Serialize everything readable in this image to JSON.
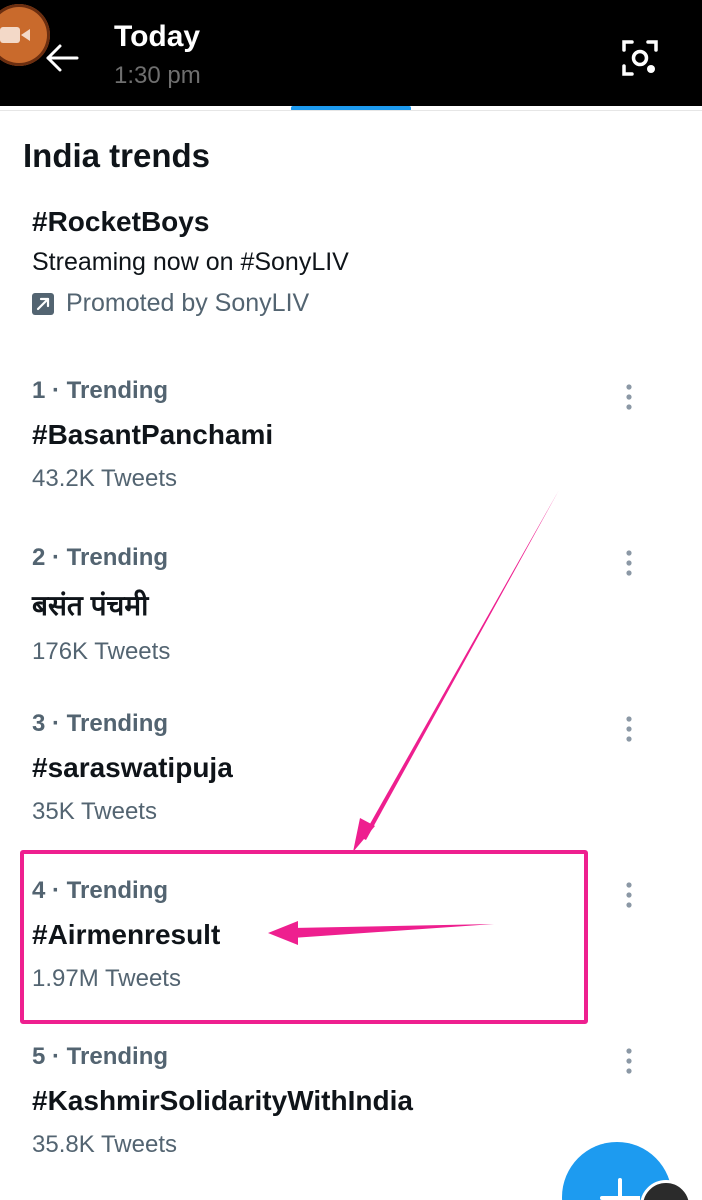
{
  "header": {
    "title": "Today",
    "time": "1:30 pm"
  },
  "section": {
    "title": "India trends"
  },
  "promoted": {
    "hashtag": "#RocketBoys",
    "subtitle": "Streaming now on #SonyLIV",
    "promoted_by": "Promoted by SonyLIV"
  },
  "trends": [
    {
      "meta": "1 · Trending",
      "name": "#BasantPanchami",
      "count": "43.2K Tweets"
    },
    {
      "meta": "2 · Trending",
      "name": "बसंत पंचमी",
      "count": "176K Tweets"
    },
    {
      "meta": "3 · Trending",
      "name": "#saraswatipuja",
      "count": "35K Tweets"
    },
    {
      "meta": "4 · Trending",
      "name": "#Airmenresult",
      "count": "1.97M Tweets"
    },
    {
      "meta": "5 · Trending",
      "name": "#KashmirSolidarityWithIndia",
      "count": "35.8K Tweets"
    }
  ],
  "colors": {
    "accent": "#1d9bf0",
    "annotation": "#ee1f8f",
    "muted": "#536471"
  }
}
